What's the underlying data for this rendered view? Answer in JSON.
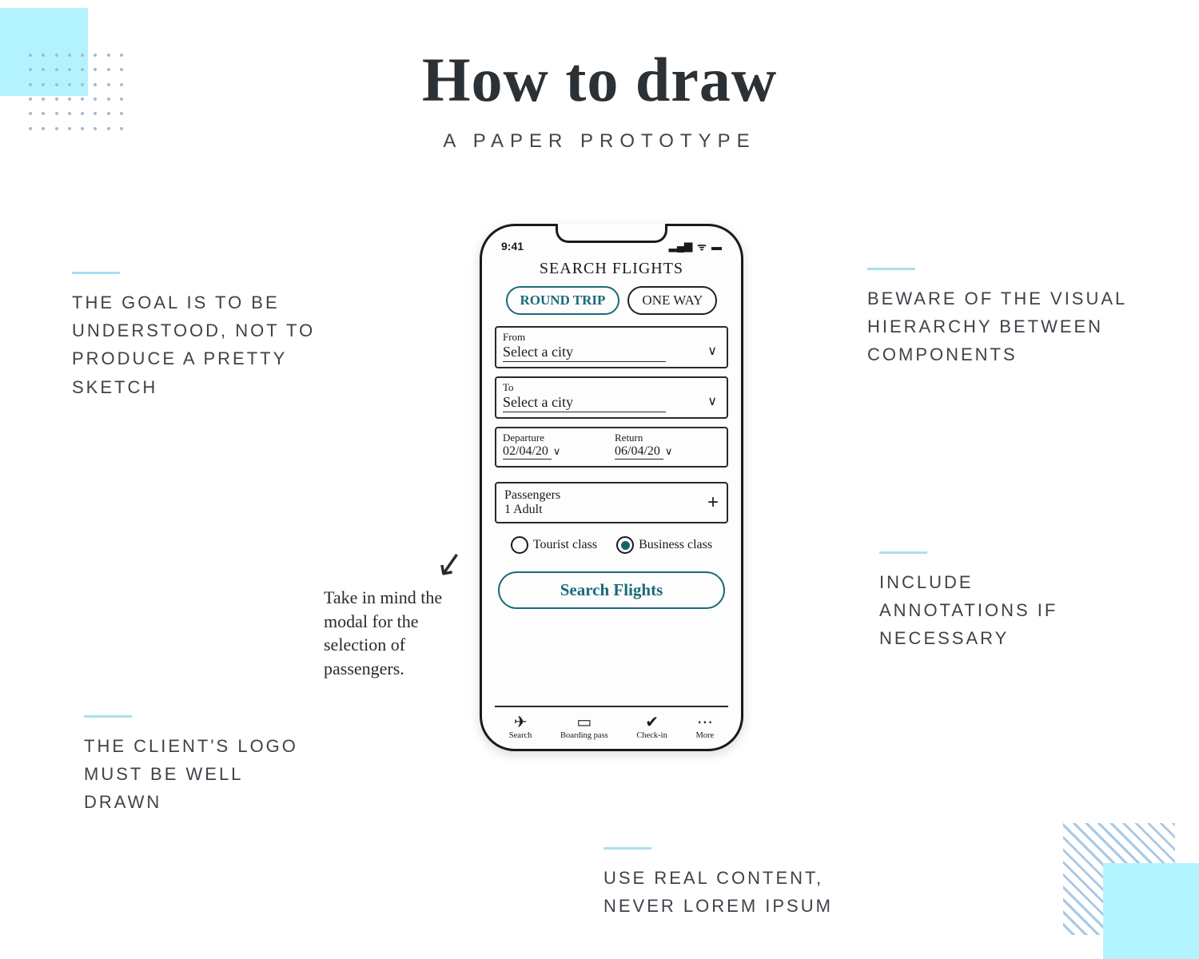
{
  "header": {
    "title": "How to draw",
    "subtitle": "A PAPER PROTOTYPE"
  },
  "tips": {
    "t1": "THE GOAL IS TO BE UNDERSTOOD, NOT TO PRODUCE A PRETTY SKETCH",
    "t2": "BEWARE OF THE VISUAL HIERARCHY BETWEEN COMPONENTS",
    "t3": "INCLUDE ANNOTATIONS IF NECESSARY",
    "t4": "THE CLIENT'S LOGO MUST BE WELL DRAWN",
    "t5": "USE REAL CONTENT, NEVER LOREM IPSUM"
  },
  "annotation": {
    "text": "Take in mind the modal for the selection of passengers."
  },
  "phone": {
    "status": {
      "time": "9:41",
      "signal": "▂▄▆",
      "wifi": "ᯤ",
      "battery": "▬"
    },
    "screen_title": "SEARCH FLIGHTS",
    "trip": {
      "round": "ROUND TRIP",
      "oneway": "ONE WAY"
    },
    "from": {
      "label": "From",
      "value": "Select a city"
    },
    "to": {
      "label": "To",
      "value": "Select a city"
    },
    "dates": {
      "dep_label": "Departure",
      "dep_value": "02/04/20",
      "ret_label": "Return",
      "ret_value": "06/04/20"
    },
    "pax": {
      "label": "Passengers",
      "value": "1 Adult",
      "add": "+"
    },
    "classes": {
      "tourist": "Tourist class",
      "business": "Business class"
    },
    "cta": "Search Flights",
    "tabs": {
      "search": "Search",
      "boarding": "Boarding pass",
      "checkin": "Check-in",
      "more": "More"
    }
  }
}
